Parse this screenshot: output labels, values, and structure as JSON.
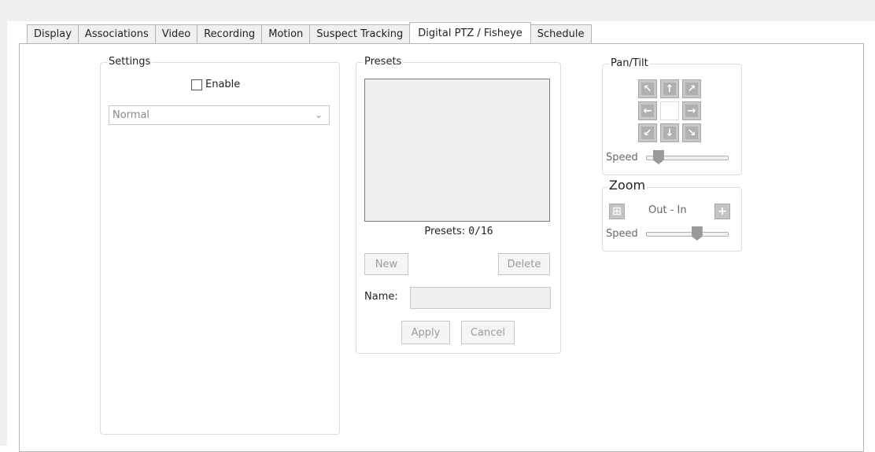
{
  "tabs": [
    {
      "label": "Display"
    },
    {
      "label": "Associations"
    },
    {
      "label": "Video"
    },
    {
      "label": "Recording"
    },
    {
      "label": "Motion"
    },
    {
      "label": "Suspect Tracking"
    },
    {
      "label": "Digital PTZ / Fisheye",
      "active": true
    },
    {
      "label": "Schedule"
    }
  ],
  "settings": {
    "title": "Settings",
    "enable_label": "Enable",
    "enable_checked": false,
    "mode_selected": "Normal"
  },
  "presets": {
    "title": "Presets",
    "count_label": "Presets:",
    "count_value": "0/16",
    "new_label": "New",
    "delete_label": "Delete",
    "name_label": "Name:",
    "name_value": "",
    "apply_label": "Apply",
    "cancel_label": "Cancel"
  },
  "pan_tilt": {
    "title": "Pan/Tilt",
    "speed_label": "Speed",
    "speed_level": 0.1
  },
  "zoom": {
    "title": "Zoom",
    "range_label": "Out - In",
    "speed_label": "Speed",
    "speed_level": 0.65
  },
  "icons": {
    "up_left": "arrow-up-left-icon",
    "up": "arrow-up-icon",
    "up_right": "arrow-up-right-icon",
    "left": "arrow-left-icon",
    "right": "arrow-right-icon",
    "down_left": "arrow-down-left-icon",
    "down": "arrow-down-icon",
    "down_right": "arrow-down-right-icon",
    "zoom_out": "zoom-out-icon",
    "zoom_in": "plus-icon"
  },
  "colors": {
    "border": "#b4b4b4",
    "disabled_text": "#9a9a9a",
    "frame_background": "#f0f0f0"
  }
}
